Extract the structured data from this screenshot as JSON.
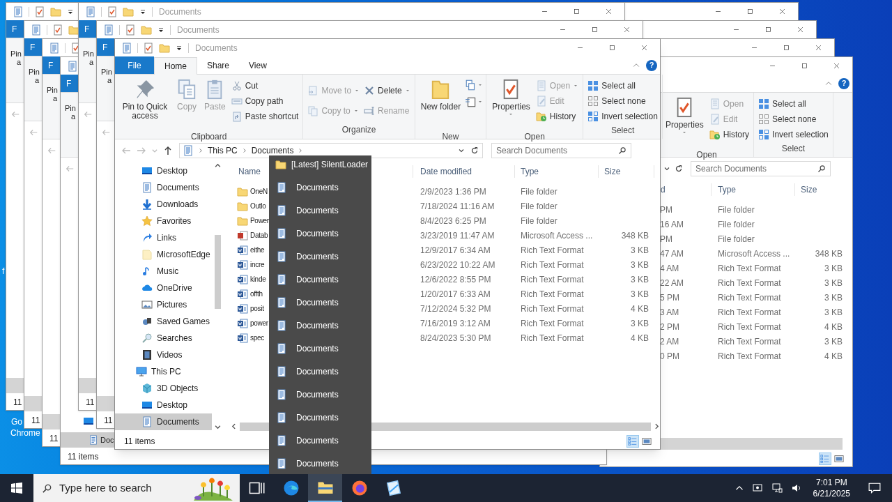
{
  "desktop": {
    "labels": [
      "f",
      "Go",
      "Chrome"
    ]
  },
  "back_windows": [
    {
      "file_tab": "F",
      "pin": "Pin",
      "pin_cut": "a",
      "status": "11"
    },
    {
      "file_tab": "F",
      "pin": "Pin",
      "pin_cut": "a",
      "status": "11"
    },
    {
      "file_tab": "F",
      "pin": "Pin",
      "pin_cut": "a",
      "status": "11"
    },
    {
      "file_tab": "F",
      "pin": "Pin",
      "pin_cut": "a",
      "sidebar_item": "Doc",
      "status": "11 items"
    },
    {
      "title": "Documents",
      "file_tab": "F",
      "pin": "Pin",
      "pin_cut": "a",
      "status": "11"
    },
    {
      "title": "Documents",
      "file_tab": "F",
      "pin": "Pin",
      "pin_cut": "a",
      "status": "11"
    }
  ],
  "right_window": {
    "help": "?",
    "ribbon_groups": [
      {
        "label": "Open",
        "buttons": [
          {
            "kind": "large",
            "label": "Properties",
            "dropdown": true,
            "disabled": false
          },
          {
            "kind": "small",
            "label": "Open",
            "disabled": true
          },
          {
            "kind": "small",
            "label": "Edit",
            "disabled": true
          },
          {
            "kind": "small",
            "label": "History",
            "disabled": false
          }
        ]
      },
      {
        "label": "Select",
        "buttons": [
          {
            "kind": "small",
            "label": "Select all",
            "disabled": false
          },
          {
            "kind": "small",
            "label": "Select none",
            "disabled": false
          },
          {
            "kind": "small",
            "label": "Invert selection",
            "disabled": false
          }
        ]
      }
    ],
    "search_placeholder": "Search Documents",
    "columns": [
      "d",
      "Type",
      "Size"
    ],
    "rows": [
      {
        "date": "PM",
        "type": "File folder"
      },
      {
        "date": "16 AM",
        "type": "File folder"
      },
      {
        "date": "PM",
        "type": "File folder"
      },
      {
        "date": "47 AM",
        "type": "Microsoft Access ...",
        "size": "348 KB"
      },
      {
        "date": "4 AM",
        "type": "Rich Text Format",
        "size": "3 KB"
      },
      {
        "date": "22 AM",
        "type": "Rich Text Format",
        "size": "3 KB"
      },
      {
        "date": "5 PM",
        "type": "Rich Text Format",
        "size": "3 KB"
      },
      {
        "date": "3 AM",
        "type": "Rich Text Format",
        "size": "3 KB"
      },
      {
        "date": "2 PM",
        "type": "Rich Text Format",
        "size": "4 KB"
      },
      {
        "date": "2 AM",
        "type": "Rich Text Format",
        "size": "3 KB"
      },
      {
        "date": "0 PM",
        "type": "Rich Text Format",
        "size": "4 KB"
      }
    ]
  },
  "window": {
    "title": "Documents",
    "help": "?",
    "tabs": [
      {
        "label": "File",
        "kind": "file",
        "selected": false
      },
      {
        "label": "Home",
        "kind": "tab",
        "selected": true
      },
      {
        "label": "Share",
        "kind": "tab",
        "selected": false
      },
      {
        "label": "View",
        "kind": "tab",
        "selected": false
      }
    ],
    "ribbon_groups": [
      {
        "label": "Clipboard",
        "buttons": [
          {
            "kind": "large",
            "label": "Pin to Quick access",
            "disabled": false
          },
          {
            "kind": "large",
            "label": "Copy",
            "disabled": true
          },
          {
            "kind": "large",
            "label": "Paste",
            "disabled": true
          },
          {
            "kind": "small",
            "label": "Cut",
            "disabled": false
          },
          {
            "kind": "small",
            "label": "Copy path",
            "disabled": false
          },
          {
            "kind": "small",
            "label": "Paste shortcut",
            "disabled": false
          }
        ]
      },
      {
        "label": "Organize",
        "buttons": [
          {
            "kind": "small",
            "label": "Move to",
            "dropdown": true,
            "disabled": true
          },
          {
            "kind": "small",
            "label": "Copy to",
            "dropdown": true,
            "disabled": true
          },
          {
            "kind": "small",
            "label": "Delete",
            "dropdown": true,
            "disabled": false
          },
          {
            "kind": "small",
            "label": "Rename",
            "disabled": true
          }
        ]
      },
      {
        "label": "New",
        "buttons": [
          {
            "kind": "large",
            "label": "New folder",
            "disabled": false
          },
          {
            "kind": "icon",
            "dropdown": true,
            "disabled": false
          },
          {
            "kind": "icon",
            "dropdown": true,
            "disabled": false
          }
        ]
      },
      {
        "label": "Open",
        "buttons": [
          {
            "kind": "large",
            "label": "Properties",
            "dropdown": true,
            "disabled": false
          },
          {
            "kind": "small",
            "label": "Open",
            "dropdown": true,
            "disabled": true
          },
          {
            "kind": "small",
            "label": "Edit",
            "disabled": true
          },
          {
            "kind": "small",
            "label": "History",
            "disabled": false
          }
        ]
      },
      {
        "label": "Select",
        "buttons": [
          {
            "kind": "small",
            "label": "Select all",
            "disabled": false
          },
          {
            "kind": "small",
            "label": "Select none",
            "disabled": false
          },
          {
            "kind": "small",
            "label": "Invert selection",
            "disabled": false
          }
        ]
      }
    ],
    "address": [
      "This PC",
      "Documents"
    ],
    "search_placeholder": "Search Documents",
    "sidebar": {
      "quick_access": [
        {
          "label": "Desktop",
          "selected": false
        },
        {
          "label": "Documents",
          "selected": false
        },
        {
          "label": "Downloads",
          "selected": false
        },
        {
          "label": "Favorites",
          "selected": false
        },
        {
          "label": "Links",
          "selected": false
        },
        {
          "label": "MicrosoftEdge",
          "selected": false
        },
        {
          "label": "Music",
          "selected": false
        },
        {
          "label": "OneDrive",
          "selected": false
        },
        {
          "label": "Pictures",
          "selected": false
        },
        {
          "label": "Saved Games",
          "selected": false
        },
        {
          "label": "Searches",
          "selected": false
        },
        {
          "label": "Videos",
          "selected": false
        }
      ],
      "tree": [
        {
          "label": "This PC",
          "selected": false,
          "children": [
            {
              "label": "3D Objects",
              "selected": false
            },
            {
              "label": "Desktop",
              "selected": false
            },
            {
              "label": "Documents",
              "selected": true
            }
          ]
        }
      ]
    },
    "columns": [
      "Name",
      "Date modified",
      "Type",
      "Size"
    ],
    "rows": [
      {
        "kind": "folder",
        "name": "OneN",
        "date": "2/9/2023 1:36 PM",
        "type": "File folder"
      },
      {
        "kind": "folder",
        "name": "Outlo",
        "date": "7/18/2024 11:16 AM",
        "type": "File folder"
      },
      {
        "kind": "folder",
        "name": "Power",
        "date": "8/4/2023 6:25 PM",
        "type": "File folder"
      },
      {
        "kind": "access",
        "name": "Datab",
        "date": "3/23/2019 11:47 AM",
        "type": "Microsoft Access ...",
        "size": "348 KB"
      },
      {
        "kind": "rtf",
        "name": "eithe",
        "date": "12/9/2017 6:34 AM",
        "type": "Rich Text Format",
        "size": "3 KB"
      },
      {
        "kind": "rtf",
        "name": "incre",
        "date": "6/23/2022 10:22 AM",
        "type": "Rich Text Format",
        "size": "3 KB"
      },
      {
        "kind": "rtf",
        "name": "kinde",
        "date": "12/6/2022 8:55 PM",
        "type": "Rich Text Format",
        "size": "3 KB"
      },
      {
        "kind": "rtf",
        "name": "offth",
        "date": "1/20/2017 6:33 AM",
        "type": "Rich Text Format",
        "size": "3 KB"
      },
      {
        "kind": "rtf",
        "name": "posit",
        "date": "7/12/2024 5:32 PM",
        "type": "Rich Text Format",
        "size": "4 KB"
      },
      {
        "kind": "rtf",
        "name": "power",
        "date": "7/16/2019 3:12 AM",
        "type": "Rich Text Format",
        "size": "3 KB"
      },
      {
        "kind": "rtf",
        "name": "spec",
        "date": "8/24/2023 5:30 PM",
        "type": "Rich Text Format",
        "size": "4 KB"
      }
    ],
    "status": "11 items"
  },
  "jump_list": {
    "header": "[Latest] SilentLoader",
    "items": [
      "Documents",
      "Documents",
      "Documents",
      "Documents",
      "Documents",
      "Documents",
      "Documents",
      "Documents",
      "Documents",
      "Documents",
      "Documents",
      "Documents",
      "Documents"
    ]
  },
  "taskbar": {
    "search_placeholder": "Type here to search",
    "apps": [
      {
        "kind": "taskview",
        "selected": false
      },
      {
        "kind": "edge",
        "selected": false
      },
      {
        "kind": "explorer",
        "selected": true
      },
      {
        "kind": "firefox",
        "selected": false
      },
      {
        "kind": "app",
        "selected": false
      }
    ],
    "time": "7:01 PM",
    "date": "6/21/2025"
  }
}
